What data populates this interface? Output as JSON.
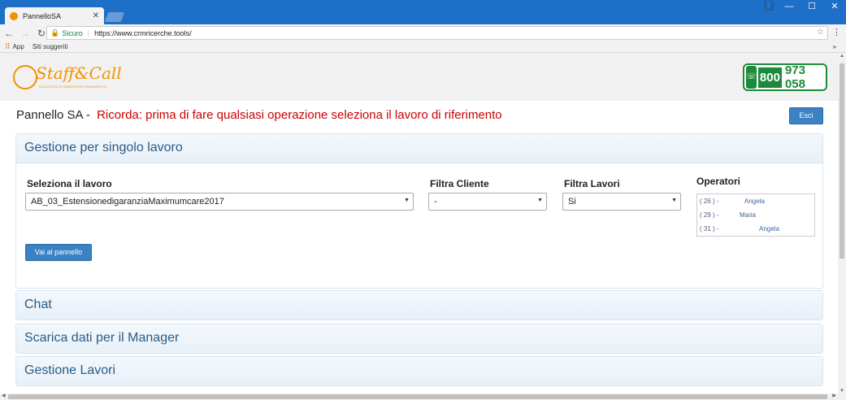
{
  "browser": {
    "tab_title": "PannelloSA",
    "secure_label": "Sicuro",
    "url": "https://www.crmricerche.tools/",
    "bookmarks": {
      "apps": "App",
      "suggested": "Siti suggeriti",
      "more": "»"
    }
  },
  "header": {
    "logo_brand": "Staff&Call",
    "logo_tagline": "SOLUZIONI DI MARKETING INNOVATIVO",
    "phone_part1": "800",
    "phone_part2": "973 058"
  },
  "title": {
    "main": "Pannello SA -",
    "warning": "Ricorda: prima di fare qualsiasi operazione seleziona il lavoro di riferimento",
    "exit_label": "Esci"
  },
  "panels": {
    "single_job": {
      "heading": "Gestione per singolo lavoro",
      "select_job_label": "Seleziona il lavoro",
      "select_job_value": "AB_03_EstensionedigaranziaMaximumcare2017",
      "filter_client_label": "Filtra Cliente",
      "filter_client_value": "-",
      "filter_jobs_label": "Filtra Lavori",
      "filter_jobs_value": "Si",
      "operators_label": "Operatori",
      "operators": [
        {
          "num": "( 26 ) -",
          "name": "Angela"
        },
        {
          "num": "( 29 ) -",
          "name": "Maria"
        },
        {
          "num": "( 31 ) -",
          "name": "Angela"
        }
      ],
      "go_button": "Vai al pannello"
    },
    "chat": {
      "heading": "Chat"
    },
    "manager": {
      "heading": "Scarica dati per il Manager"
    },
    "jobs": {
      "heading": "Gestione Lavori"
    }
  },
  "colors": {
    "accent": "#3a82c4",
    "warning": "#cc0000",
    "panel_heading": "#2a5b87",
    "brand_orange": "#f39200",
    "phone_green": "#1c8a3a",
    "chrome_blue": "#1e6fc7"
  }
}
